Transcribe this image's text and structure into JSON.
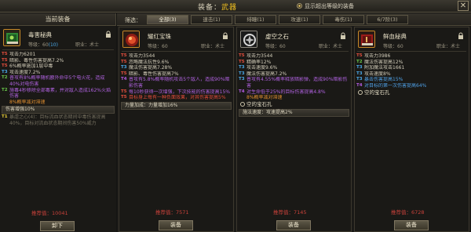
{
  "window": {
    "title_prefix": "装备：",
    "title_category": "武器",
    "hint": "显示超出等级的装备",
    "close": "✕"
  },
  "left": {
    "header": "当前装备",
    "card": {
      "name": "毒害秘典",
      "level_label": "等级：60",
      "level_bonus": "(10)",
      "job": "职业：术士",
      "attrs": [
        {
          "tier": "T5",
          "text": "攻击力6201",
          "color": "c-white"
        },
        {
          "tier": "T5",
          "text": "暗影、毒性伤害提高7.2%",
          "color": "c-white"
        },
        {
          "tier": "T5",
          "text": "6%概率施加1层中毒",
          "color": "c-white"
        },
        {
          "tier": "T3",
          "text": "攻击速度7.2%",
          "color": "c-white"
        },
        {
          "tier": "T2",
          "text": "普攻有8%概率随机额外命中5个电火花，造成40%对电伤害",
          "color": "c-purple",
          "wrap": true
        },
        {
          "tier": "T2",
          "text": "施毒4秒移除全部毒素，并对敌人造成162%火焰伤害",
          "color": "c-purple",
          "wrap": true
        },
        {
          "tier": "",
          "text": "8%概率减对滞速",
          "color": "c-orange"
        }
      ],
      "bar": "伤害增强10%",
      "extra": [
        {
          "tier": "T1",
          "text": "暴虐之心(4)：目标流血状态期间中毒伤害提高40%，目标对流血状态期间伤害50%威力",
          "color": "c-gray",
          "wrap": true
        }
      ],
      "score_label": "推荐值：",
      "score_value": "10041",
      "button": "卸下"
    }
  },
  "right": {
    "filter_label": "筛选：",
    "tabs": [
      {
        "label": "全部(3)",
        "active": true
      },
      {
        "label": "速击(1)",
        "active": false
      },
      {
        "label": "绯瞳(1)",
        "active": false
      },
      {
        "label": "攻速(1)",
        "active": false
      },
      {
        "label": "毒伤(1)",
        "active": false
      },
      {
        "label": "6/7阶(3)",
        "active": false
      }
    ],
    "cards": [
      {
        "name": "耀红宝珠",
        "level_label": "等级：60",
        "job": "职业：术士",
        "attrs": [
          {
            "tier": "T5",
            "text": "攻击力3544",
            "color": "c-white"
          },
          {
            "tier": "T5",
            "text": "忽略魔法抗性9.6%",
            "color": "c-white"
          },
          {
            "tier": "T3",
            "text": "魔法伤害提高7.28%",
            "color": "c-white"
          },
          {
            "tier": "T5",
            "text": "暗影、毒性伤害提高7%",
            "color": "c-white"
          },
          {
            "tier": "T4",
            "text": "普攻有5.8%概率随机攻击5个敌人，造成90%暗影伤害",
            "color": "c-purple",
            "wrap": true
          },
          {
            "tier": "T5",
            "text": "每10秒获得一次增强，下次技能的伤害提高15%",
            "color": "c-purple",
            "wrap": true
          },
          {
            "tier": "T5",
            "text": "目标身上每有一种负面效果，对其伤害提高5%",
            "color": "c-red",
            "wrap": true
          }
        ],
        "bar": "力量加成：力量增加16%",
        "socket": "",
        "score_label": "推荐值：",
        "score_value": "7571",
        "button": "装备"
      },
      {
        "name": "虚空之石",
        "level_label": "等级：60",
        "job": "职业：术士",
        "attrs": [
          {
            "tier": "T5",
            "text": "攻击力3544",
            "color": "c-white"
          },
          {
            "tier": "T5",
            "text": "精确率12%",
            "color": "c-white"
          },
          {
            "tier": "T3",
            "text": "攻击速度9.6%",
            "color": "c-white"
          },
          {
            "tier": "T3",
            "text": "魔法伤害提高7.2%",
            "color": "c-white"
          },
          {
            "tier": "T3",
            "text": "普攻有4.55%概率释放暗影弹，造成90%暗影伤害",
            "color": "c-purple",
            "wrap": true
          },
          {
            "tier": "T4",
            "text": "对生命低于25%的目标伤害提高4.8%",
            "color": "c-purple",
            "wrap": true
          },
          {
            "tier": "",
            "text": "8%概率减对滞速",
            "color": "c-orange"
          }
        ],
        "bar": "",
        "socket": "空的宝石孔",
        "bar2": "施法速度：攻速提高2%",
        "score_label": "推荐值：",
        "score_value": "7145",
        "button": "装备"
      },
      {
        "name": "鲜血秘典",
        "level_label": "等级：60",
        "job": "职业：术士",
        "attrs": [
          {
            "tier": "T5",
            "text": "攻击力3986",
            "color": "c-white"
          },
          {
            "tier": "T2",
            "text": "魔法伤害提高12%",
            "color": "c-white"
          },
          {
            "tier": "T3",
            "text": "附加魔法攻击1661",
            "color": "c-white"
          },
          {
            "tier": "T3",
            "text": "攻击速度8%",
            "color": "c-white"
          },
          {
            "tier": "T3",
            "text": "暴击伤害提高15%",
            "color": "c-blue"
          },
          {
            "tier": "T4",
            "text": "对目标的第一次伤害提高64%",
            "color": "c-blue"
          }
        ],
        "bar": "",
        "socket": "空的宝石孔",
        "score_label": "推荐值：",
        "score_value": "6728",
        "button": "装备"
      }
    ]
  }
}
